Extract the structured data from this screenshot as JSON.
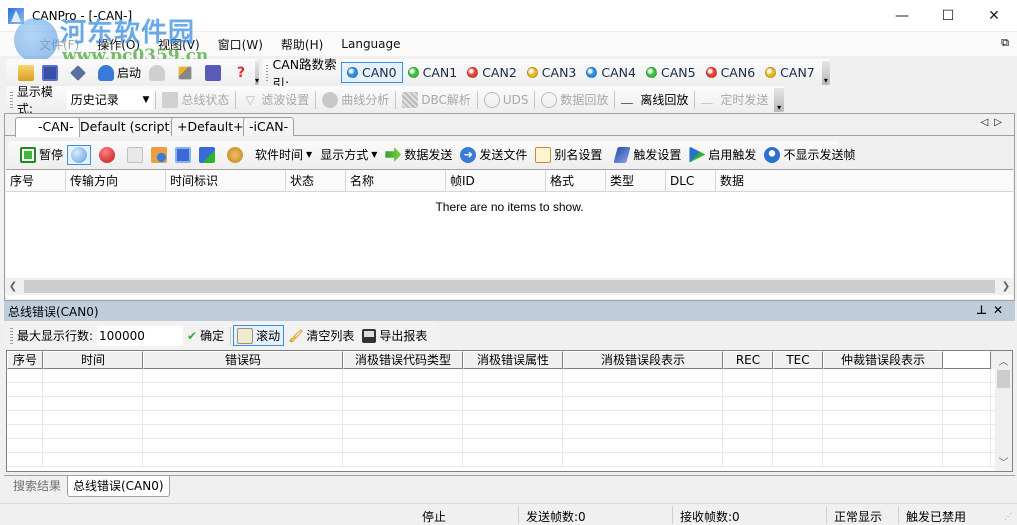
{
  "window": {
    "title": "CANPro - [-CAN-]",
    "controls": {
      "minimize": "—",
      "maximize": "☐",
      "close": "✕"
    }
  },
  "menubar": {
    "items": [
      "文件(F)",
      "操作(O)",
      "视图(V)",
      "窗口(W)",
      "帮助(H)",
      "Language"
    ],
    "restore_icon": "⧉"
  },
  "toolbar_main": {
    "start_label": "启动",
    "can_index_label": "CAN路数索引:",
    "can_channels": [
      {
        "label": "CAN0",
        "color": "#2a8ee8",
        "active": true
      },
      {
        "label": "CAN1",
        "color": "#3cc23c",
        "active": false
      },
      {
        "label": "CAN2",
        "color": "#e8402a",
        "active": false
      },
      {
        "label": "CAN3",
        "color": "#e8b820",
        "active": false
      },
      {
        "label": "CAN4",
        "color": "#2a8ee8",
        "active": false
      },
      {
        "label": "CAN5",
        "color": "#3cc23c",
        "active": false
      },
      {
        "label": "CAN6",
        "color": "#e8402a",
        "active": false
      },
      {
        "label": "CAN7",
        "color": "#e8b820",
        "active": false
      }
    ]
  },
  "toolbar_mode": {
    "display_mode_label": "显示模式:",
    "display_mode_value": "历史记录",
    "buttons": [
      {
        "label": "总线状态",
        "enabled": false
      },
      {
        "label": "滤波设置",
        "enabled": false
      },
      {
        "label": "曲线分析",
        "enabled": false
      },
      {
        "label": "DBC解析",
        "enabled": false
      },
      {
        "label": "UDS",
        "enabled": false
      },
      {
        "label": "数据回放",
        "enabled": false
      },
      {
        "label": "离线回放",
        "enabled": true
      },
      {
        "label": "定时发送",
        "enabled": false
      }
    ]
  },
  "doc_tabs": [
    {
      "label": "-CAN-",
      "active": true
    },
    {
      "label": "Default (script)",
      "active": false
    },
    {
      "label": "+Default+",
      "active": false
    },
    {
      "label": "-iCAN-",
      "active": false
    }
  ],
  "tab_nav": {
    "prev": "◁",
    "next": "▷"
  },
  "can_toolbar": {
    "pause": "暂停",
    "software_time": "软件时间",
    "display_method": "显示方式",
    "send_data": "数据发送",
    "send_file": "发送文件",
    "alias_settings": "别名设置",
    "trigger_settings": "触发设置",
    "enable_trigger": "启用触发",
    "hide_sent_frames": "不显示发送帧"
  },
  "frame_grid": {
    "columns": [
      "序号",
      "传输方向",
      "时间标识",
      "状态",
      "名称",
      "帧ID",
      "格式",
      "类型",
      "DLC",
      "数据"
    ],
    "empty_message": "There are no items to show."
  },
  "bus_error_panel": {
    "title": "总线错误(CAN0)",
    "pin_icon": "⊥",
    "close_icon": "✕",
    "max_rows_label": "最大显示行数:",
    "max_rows_value": "100000",
    "confirm": "确定",
    "scroll": "滚动",
    "clear_list": "清空列表",
    "export_report": "导出报表",
    "columns": [
      "序号",
      "时间",
      "错误码",
      "消极错误代码类型",
      "消极错误属性",
      "消极错误段表示",
      "REC",
      "TEC",
      "仲裁错误段表示",
      ""
    ]
  },
  "bottom_tabs": [
    {
      "label": "搜索结果",
      "active": false
    },
    {
      "label": "总线错误(CAN0)",
      "active": true
    }
  ],
  "statusbar": {
    "state": "停止",
    "sent_frames": "发送帧数:0",
    "received_frames": "接收帧数:0",
    "display_state": "正常显示",
    "trigger_state": "触发已禁用"
  },
  "watermark": {
    "text": "河东软件园",
    "url": "www.pc0359.cn"
  }
}
